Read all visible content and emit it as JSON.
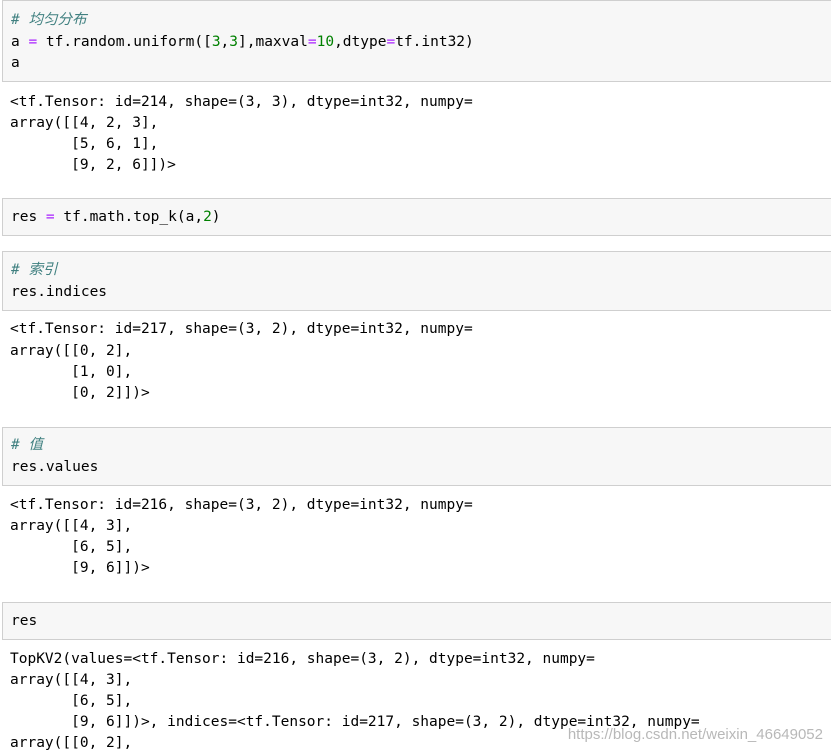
{
  "cells": [
    {
      "id": "cell-uniform",
      "input": [
        {
          "comment": "# 均匀分布"
        },
        {
          "code": "a = tf.random.uniform([3,3],maxval=10,dtype=tf.int32)"
        },
        {
          "code": "a"
        }
      ],
      "output": [
        "<tf.Tensor: id=214, shape=(3, 3), dtype=int32, numpy=",
        "array([[4, 2, 3],",
        "       [5, 6, 1],",
        "       [9, 2, 6]])>"
      ]
    },
    {
      "id": "cell-topk",
      "input": [
        {
          "code": "res = tf.math.top_k(a,2)"
        }
      ],
      "output": []
    },
    {
      "id": "cell-indices",
      "input": [
        {
          "comment": "# 索引"
        },
        {
          "code": "res.indices"
        }
      ],
      "output": [
        "<tf.Tensor: id=217, shape=(3, 2), dtype=int32, numpy=",
        "array([[0, 2],",
        "       [1, 0],",
        "       [0, 2]])>"
      ]
    },
    {
      "id": "cell-values",
      "input": [
        {
          "comment": "# 值"
        },
        {
          "code": "res.values"
        }
      ],
      "output": [
        "<tf.Tensor: id=216, shape=(3, 2), dtype=int32, numpy=",
        "array([[4, 3],",
        "       [6, 5],",
        "       [9, 6]])>"
      ]
    },
    {
      "id": "cell-res",
      "input": [
        {
          "code": "res"
        }
      ],
      "output": [
        "TopKV2(values=<tf.Tensor: id=216, shape=(3, 2), dtype=int32, numpy=",
        "array([[4, 3],",
        "       [6, 5],",
        "       [9, 6]])>, indices=<tf.Tensor: id=217, shape=(3, 2), dtype=int32, numpy=",
        "array([[0, 2],"
      ]
    }
  ],
  "watermark": "https://blog.csdn.net/weixin_46649052"
}
